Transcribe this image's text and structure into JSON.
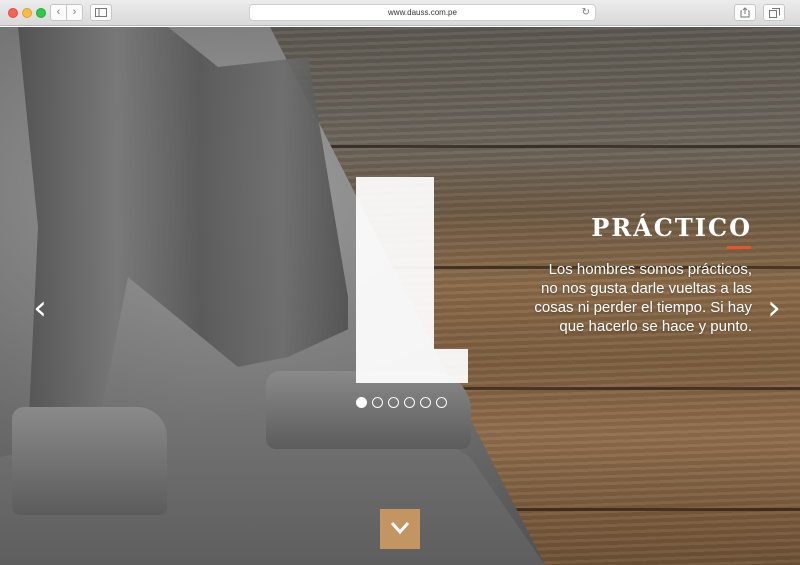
{
  "browser": {
    "url": "www.dauss.com.pe",
    "icons": {
      "back": "chevron-left-icon",
      "forward": "chevron-right-icon",
      "sidebar": "sidebar-icon",
      "reload": "reload-icon",
      "share": "share-icon",
      "tabs": "tabs-icon"
    }
  },
  "hero": {
    "headline": "PRÁCTICO",
    "body_lines": [
      "Los hombres somos prácticos,",
      "no nos gusta darle vueltas a las",
      "cosas ni perder el tiempo. Si hay",
      "que hacerlo se hace y punto."
    ],
    "accent_color": "#e4572e",
    "button_color": "#c29562"
  },
  "slider": {
    "slide_count": 6,
    "active_index": 0,
    "prev_glyph": "‹",
    "next_glyph": "›"
  }
}
